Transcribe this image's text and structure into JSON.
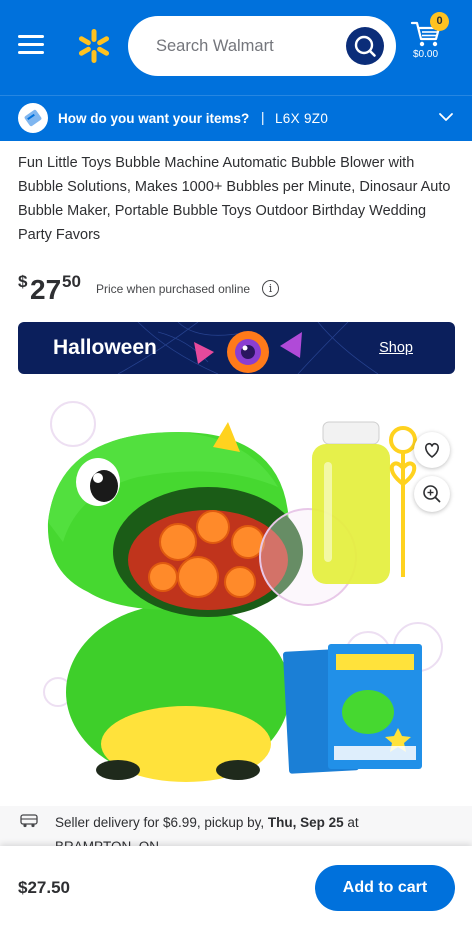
{
  "header": {
    "search_placeholder": "Search Walmart",
    "cart_count": "0",
    "cart_total": "$0.00"
  },
  "delivery_bar": {
    "question": "How do you want your items?",
    "separator": "|",
    "postal_code": "L6X 9Z0"
  },
  "product": {
    "title": "Fun Little Toys Bubble Machine Automatic Bubble Blower with Bubble Solutions, Makes 1000+ Bubbles per Minute, Dinosaur Auto Bubble Maker, Portable Bubble Toys Outdoor Birthday Wedding Party Favors",
    "price_currency": "$",
    "price_dollars": "27",
    "price_cents": "50",
    "price_note": "Price when purchased online",
    "image_alt": "Green dinosaur bubble machine with bubble solution bottles and wand"
  },
  "banner": {
    "label": "Halloween",
    "link": "Shop"
  },
  "seller": {
    "text_before": "Seller delivery for $6.99, pickup by, ",
    "date": "Thu, Sep 25",
    "text_after": " at",
    "location": "BRAMPTON, ON"
  },
  "bottom_bar": {
    "price": "$27.50",
    "add_to_cart": "Add to cart"
  },
  "colors": {
    "brand_blue": "#0071dc",
    "dark_blue": "#0b2d79",
    "spark_yellow": "#ffc220",
    "banner_navy": "#0b1f5c"
  },
  "icons": [
    "menu-icon",
    "walmart-spark-icon",
    "search-icon",
    "cart-icon",
    "delivery-icon",
    "chevron-down-icon",
    "info-icon",
    "heart-icon",
    "zoom-in-icon",
    "truck-icon"
  ]
}
